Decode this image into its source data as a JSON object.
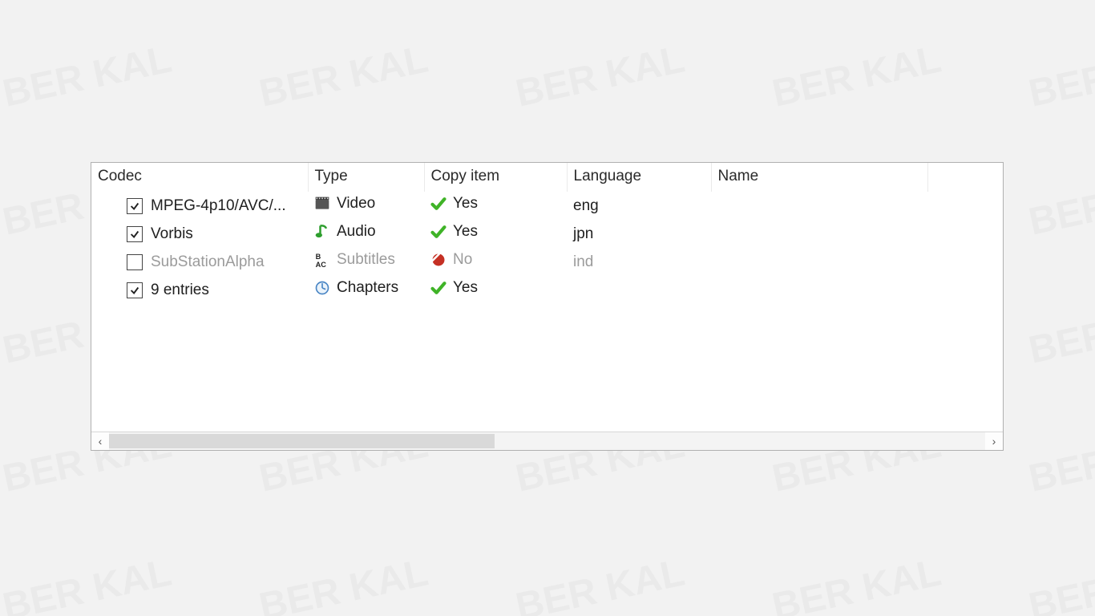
{
  "columns": {
    "codec": "Codec",
    "type": "Type",
    "copy": "Copy item",
    "lang": "Language",
    "name": "Name"
  },
  "rows": [
    {
      "checked": true,
      "enabled": true,
      "codec": "MPEG-4p10/AVC/...",
      "type_icon": "video-icon",
      "type": "Video",
      "copy_ok": true,
      "copy": "Yes",
      "language": "eng",
      "name": ""
    },
    {
      "checked": true,
      "enabled": true,
      "codec": "Vorbis",
      "type_icon": "audio-icon",
      "type": "Audio",
      "copy_ok": true,
      "copy": "Yes",
      "language": "jpn",
      "name": ""
    },
    {
      "checked": false,
      "enabled": false,
      "codec": "SubStationAlpha",
      "type_icon": "subtitles-icon",
      "type": "Subtitles",
      "copy_ok": false,
      "copy": "No",
      "language": "ind",
      "name": ""
    },
    {
      "checked": true,
      "enabled": true,
      "codec": "9 entries",
      "type_icon": "chapters-icon",
      "type": "Chapters",
      "copy_ok": true,
      "copy": "Yes",
      "language": "",
      "name": ""
    }
  ],
  "scroll": {
    "left_glyph": "‹",
    "right_glyph": "›"
  }
}
